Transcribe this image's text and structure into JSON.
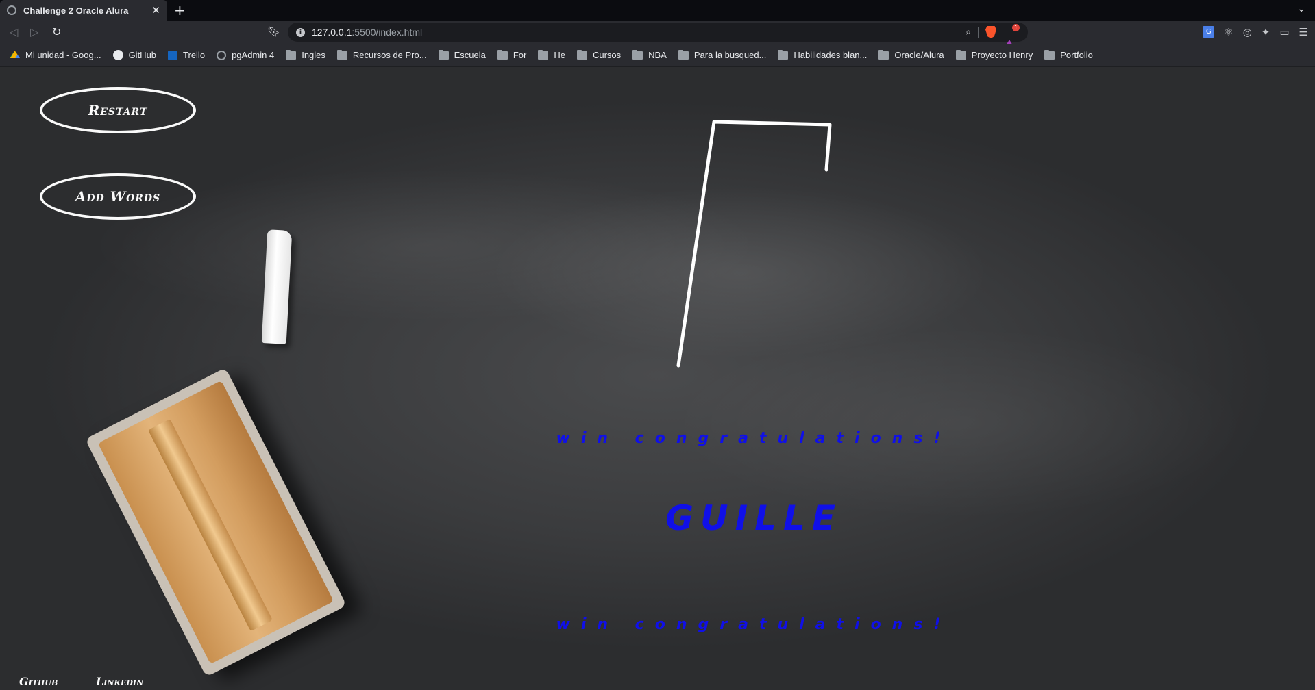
{
  "browser": {
    "tab_title": "Challenge 2 Oracle Alura",
    "url_host": "127.0.0.1",
    "url_path": ":5500/index.html",
    "bookmarks": [
      {
        "label": "Mi unidad - Goog...",
        "icon": "drive-icon"
      },
      {
        "label": "GitHub",
        "icon": "github-icon"
      },
      {
        "label": "Trello",
        "icon": "trello-icon"
      },
      {
        "label": "pgAdmin 4",
        "icon": "globe-icon"
      },
      {
        "label": "Ingles",
        "icon": "folder-icon"
      },
      {
        "label": "Recursos de Pro...",
        "icon": "folder-icon"
      },
      {
        "label": "Escuela",
        "icon": "folder-icon"
      },
      {
        "label": "For",
        "icon": "folder-icon"
      },
      {
        "label": "He",
        "icon": "folder-icon"
      },
      {
        "label": "Cursos",
        "icon": "folder-icon"
      },
      {
        "label": "NBA",
        "icon": "folder-icon"
      },
      {
        "label": "Para la busqued...",
        "icon": "folder-icon"
      },
      {
        "label": "Habilidades blan...",
        "icon": "folder-icon"
      },
      {
        "label": "Oracle/Alura",
        "icon": "folder-icon"
      },
      {
        "label": "Proyecto Henry",
        "icon": "folder-icon"
      },
      {
        "label": "Portfolio",
        "icon": "folder-icon"
      }
    ],
    "rewards_badge": "1"
  },
  "game": {
    "restart_label": "Restart",
    "add_words_label": "Add Words",
    "win_message_top": "win congratulations!",
    "word": "GUILLE",
    "win_message_bottom": "win congratulations!",
    "text_color": "#1010e8"
  },
  "footer": {
    "github_label": "Github",
    "linkedin_label": "Linkedin"
  }
}
